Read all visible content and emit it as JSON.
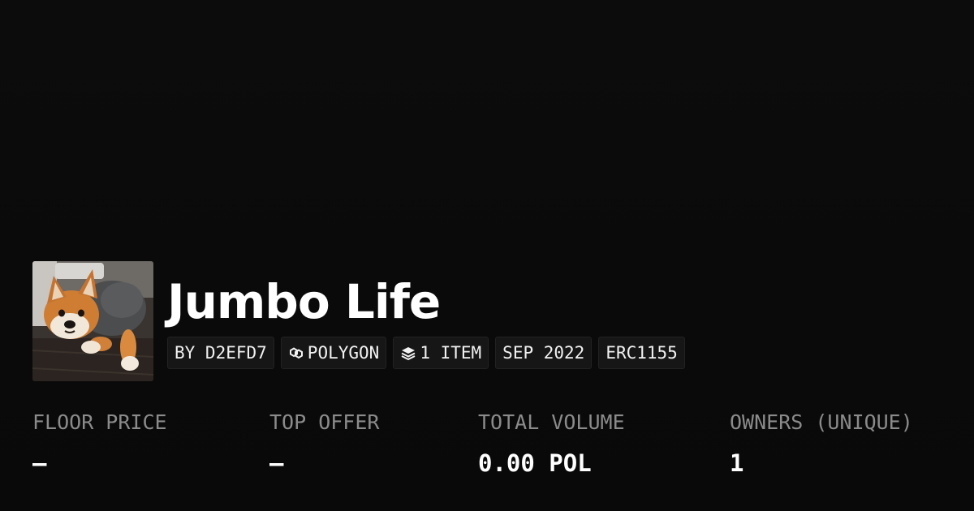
{
  "collection": {
    "title": "Jumbo Life",
    "avatar_icon": "shiba-inu-dog-photo"
  },
  "tags": {
    "creator": "BY D2EFD7",
    "chain": "POLYGON",
    "chain_icon": "polygon-chain-icon",
    "items": "1 ITEM",
    "items_icon": "layers-icon",
    "date": "SEP 2022",
    "standard": "ERC1155"
  },
  "stats": {
    "floor_price": {
      "label": "FLOOR PRICE",
      "value": "–"
    },
    "top_offer": {
      "label": "TOP OFFER",
      "value": "–"
    },
    "total_volume": {
      "label": "TOTAL VOLUME",
      "value": "0.00 POL"
    },
    "owners": {
      "label": "OWNERS (UNIQUE)",
      "value": "1"
    }
  },
  "colors": {
    "background": "#0a0a0a",
    "text": "#ffffff",
    "label": "#8b8b8b",
    "tag_bg": "#161616"
  }
}
